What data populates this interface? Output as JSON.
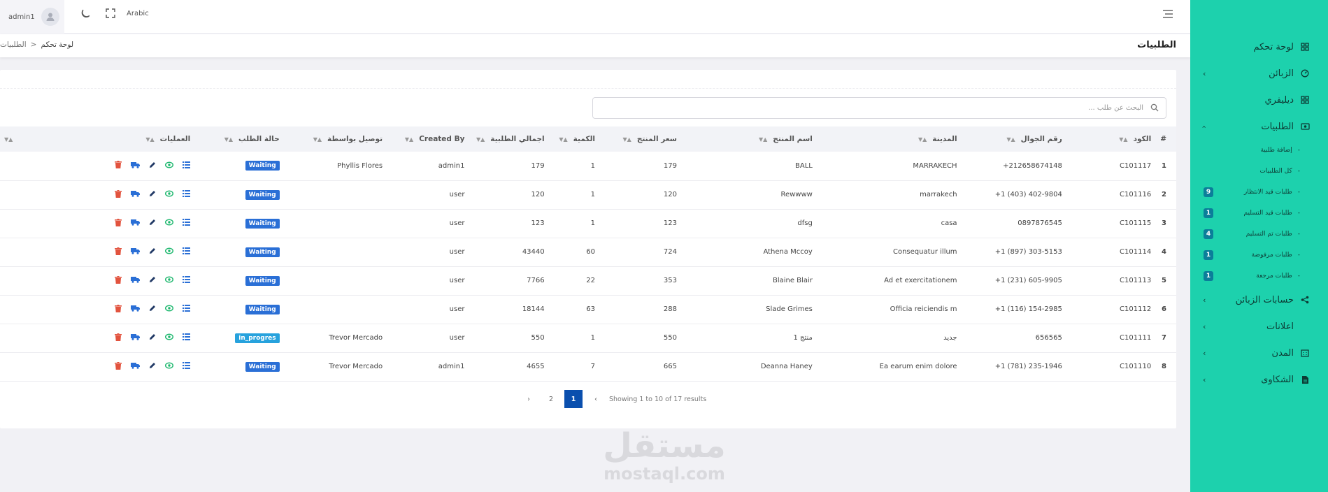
{
  "header": {
    "user_name": "admin1",
    "language": "Arabic"
  },
  "breadcrumb": {
    "title": "الطلبيات",
    "home": "لوحة تحكم",
    "separator": "<",
    "current": "الطلبيات"
  },
  "sidebar": {
    "items": [
      {
        "label": "لوحة تحكم",
        "icon": "dashboard-icon",
        "has_chevron": false
      },
      {
        "label": "الزبائن",
        "icon": "gauge-icon",
        "has_chevron": true
      },
      {
        "label": "ديليفري",
        "icon": "grid-icon",
        "has_chevron": false
      },
      {
        "label": "الطلبيات",
        "icon": "orders-icon",
        "has_chevron": true,
        "expanded": true
      }
    ],
    "sub_items": [
      {
        "label": "إضافة طلبية",
        "badge": ""
      },
      {
        "label": "كل الطلبيات",
        "badge": ""
      },
      {
        "label": "طلبات قيد الانتظار",
        "badge": "9"
      },
      {
        "label": "طلبات قيد التسليم",
        "badge": "1"
      },
      {
        "label": "طلبات تم التسليم",
        "badge": "4"
      },
      {
        "label": "طلبات مرفوضة",
        "badge": "1"
      },
      {
        "label": "طلبات مرجعة",
        "badge": "1"
      }
    ],
    "items_after": [
      {
        "label": "حسابات الزبائن",
        "icon": "share-icon"
      },
      {
        "label": "اعلانات",
        "icon": "ads-icon"
      },
      {
        "label": "المدن",
        "icon": "building-icon"
      },
      {
        "label": "الشكاوى",
        "icon": "document-icon"
      }
    ],
    "background": "#1dd1ad"
  },
  "search": {
    "placeholder": "البحث عن طلب ..."
  },
  "table": {
    "columns": [
      "#",
      "الكود",
      "رقم الجوال",
      "المدينة",
      "اسم المنتج",
      "سعر المنتج",
      "الكمية",
      "اجمالي الطلبية",
      "Created By",
      "توصيل بواسطة",
      "حالة الطلب",
      "العمليات"
    ],
    "rows": [
      {
        "idx": "1",
        "code": "C101117",
        "phone": "+212658674148",
        "city": "MARRAKECH",
        "product": "BALL",
        "price": "179",
        "qty": "1",
        "total": "179",
        "created_by": "admin1",
        "delivery": "Phyllis Flores",
        "status": "Waiting"
      },
      {
        "idx": "2",
        "code": "C101116",
        "phone": "+1 (403) 402-9804",
        "city": "marrakech",
        "product": "Rewwww",
        "price": "120",
        "qty": "1",
        "total": "120",
        "created_by": "user",
        "delivery": "",
        "status": "Waiting"
      },
      {
        "idx": "3",
        "code": "C101115",
        "phone": "0897876545",
        "city": "casa",
        "product": "dfsg",
        "price": "123",
        "qty": "1",
        "total": "123",
        "created_by": "user",
        "delivery": "",
        "status": "Waiting"
      },
      {
        "idx": "4",
        "code": "C101114",
        "phone": "+1 (897) 303-5153",
        "city": "Consequatur illum",
        "product": "Athena Mccoy",
        "price": "724",
        "qty": "60",
        "total": "43440",
        "created_by": "user",
        "delivery": "",
        "status": "Waiting"
      },
      {
        "idx": "5",
        "code": "C101113",
        "phone": "+1 (231) 605-9905",
        "city": "Ad et exercitationem",
        "product": "Blaine Blair",
        "price": "353",
        "qty": "22",
        "total": "7766",
        "created_by": "user",
        "delivery": "",
        "status": "Waiting"
      },
      {
        "idx": "6",
        "code": "C101112",
        "phone": "+1 (116) 154-2985",
        "city": "Officia reiciendis m",
        "product": "Slade Grimes",
        "price": "288",
        "qty": "63",
        "total": "18144",
        "created_by": "user",
        "delivery": "",
        "status": "Waiting"
      },
      {
        "idx": "7",
        "code": "C101111",
        "phone": "656565",
        "city": "جديد",
        "product": "منتج 1",
        "price": "550",
        "qty": "1",
        "total": "550",
        "created_by": "user",
        "delivery": "Trevor Mercado",
        "status": "in_progres"
      },
      {
        "idx": "8",
        "code": "C101110",
        "phone": "+1 (781) 235-1946",
        "city": "Ea earum enim dolore",
        "product": "Deanna Haney",
        "price": "665",
        "qty": "7",
        "total": "4655",
        "created_by": "admin1",
        "delivery": "Trevor Mercado",
        "status": "Waiting"
      }
    ],
    "status_colors": {
      "Waiting": "#2a6fd6",
      "in_progres": "#27a2dd"
    },
    "action_icons": [
      "list-icon",
      "view-icon",
      "edit-icon",
      "truck-icon",
      "delete-icon"
    ]
  },
  "pagination": {
    "info": "Showing 1 to 10 of 17 results",
    "pages": [
      "1",
      "2"
    ],
    "active": "1",
    "prev": "‹",
    "next": "›"
  },
  "watermark": {
    "arabic": "مستقل",
    "latin": "mostaql.com"
  }
}
